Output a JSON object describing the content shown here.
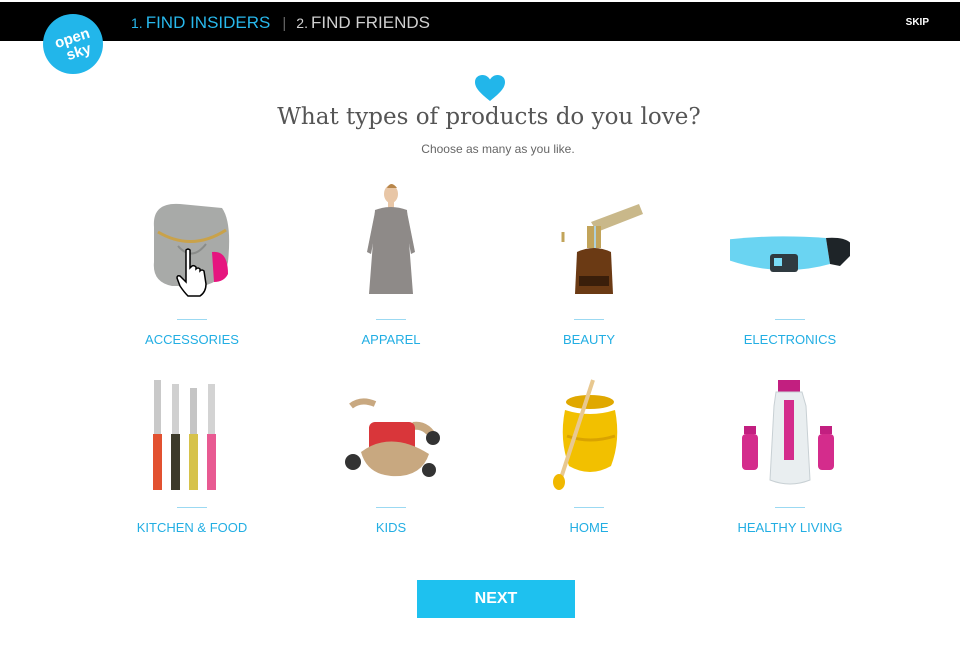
{
  "header": {
    "steps": [
      {
        "num": "1.",
        "label": "FIND INSIDERS"
      },
      {
        "num": "2.",
        "label": "FIND FRIENDS"
      }
    ],
    "separator": "|",
    "skip_label": "SKIP"
  },
  "logo": {
    "line1": "open",
    "line2": "sky"
  },
  "main": {
    "title": "What types of products do you love?",
    "subtitle": "Choose as many as you like."
  },
  "categories": [
    {
      "label": "ACCESSORIES"
    },
    {
      "label": "APPAREL"
    },
    {
      "label": "BEAUTY"
    },
    {
      "label": "ELECTRONICS"
    },
    {
      "label": "KITCHEN & FOOD"
    },
    {
      "label": "KIDS"
    },
    {
      "label": "HOME"
    },
    {
      "label": "HEALTHY LIVING"
    }
  ],
  "next_label": "NEXT",
  "colors": {
    "accent": "#22b6ea",
    "topbar": "#000000",
    "button": "#1ec1ef"
  }
}
